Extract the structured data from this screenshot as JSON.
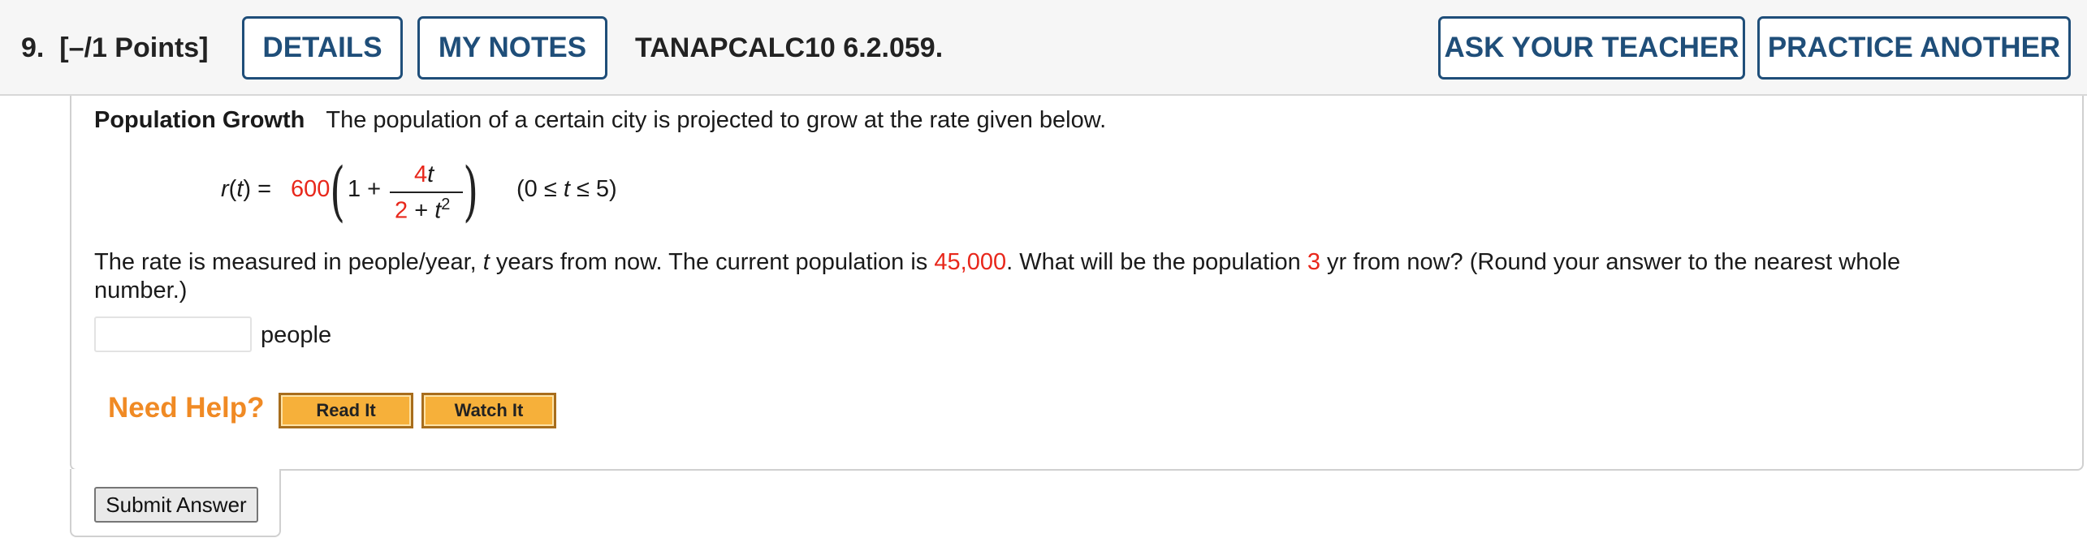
{
  "header": {
    "question_number": "9.",
    "points": "[–/1 Points]",
    "details_label": "DETAILS",
    "my_notes_label": "MY NOTES",
    "question_id": "TANAPCALC10 6.2.059.",
    "ask_teacher_label": "ASK YOUR TEACHER",
    "practice_another_label": "PRACTICE ANOTHER"
  },
  "problem": {
    "title": "Population Growth",
    "intro": "The population of a certain city is projected to grow at the rate given below.",
    "formula": {
      "lhs": "r(t) = ",
      "coefficient": "600",
      "one_plus": "1 + ",
      "numerator": "4t",
      "denominator_const": "2",
      "denominator_rest": " + t",
      "exponent": "2",
      "domain": "(0 ≤ t ≤ 5)"
    },
    "rate_text_1": "The rate is measured in people/year, ",
    "rate_var": "t",
    "rate_text_2": " years from now. The current population is ",
    "current_population": "45,000",
    "rate_text_3": ". What will be the population ",
    "years": "3",
    "rate_text_4": " yr from now? (Round your answer to the nearest whole number.)",
    "answer_value": "",
    "answer_unit": "people"
  },
  "help": {
    "label": "Need Help?",
    "read_it_label": "Read It",
    "watch_it_label": "Watch It"
  },
  "submit_label": "Submit Answer",
  "colors": {
    "accent_blue": "#1f4e79",
    "highlight_red": "#e8271b",
    "help_orange": "#f08a24"
  }
}
